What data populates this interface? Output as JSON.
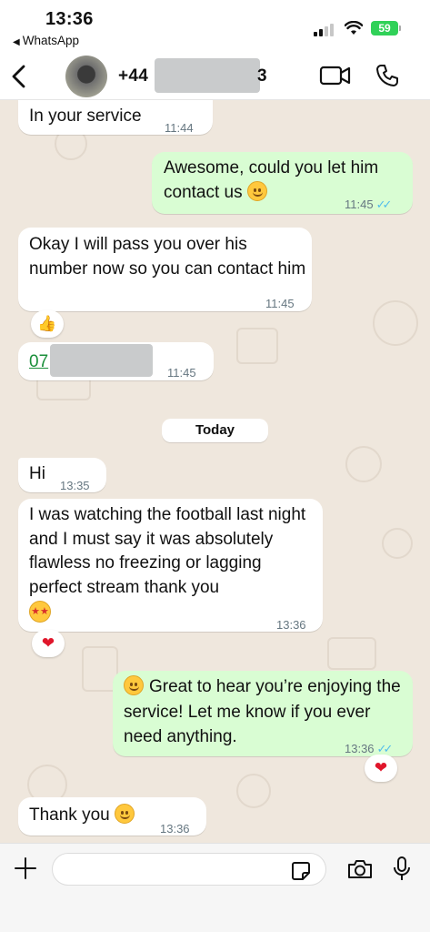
{
  "status_bar": {
    "time": "13:36",
    "back_app": "WhatsApp",
    "battery": "59"
  },
  "header": {
    "contact_prefix": "+44",
    "contact_suffix": "3"
  },
  "messages": [
    {
      "direction": "in",
      "text": "In your service",
      "time": "11:44"
    },
    {
      "direction": "out",
      "text": "Awesome, could you let him contact us",
      "emoji": "smiling-face",
      "time": "11:45",
      "read": true
    },
    {
      "direction": "in",
      "text": "Okay I will pass you over his number now so you can contact him",
      "time": "11:45",
      "reaction": "👍"
    },
    {
      "direction": "in",
      "link_text": "07",
      "time": "11:45"
    },
    {
      "direction": "in",
      "text": "Hi",
      "time": "13:35"
    },
    {
      "direction": "in",
      "text": "I was watching the football last night and I must say it was absolutely flawless no freezing or lagging perfect stream thank you",
      "emoji": "star-struck",
      "time": "13:36",
      "reaction": "❤"
    },
    {
      "direction": "out",
      "text": "Great to hear you’re enjoying the service! Let me know if you ever need anything.",
      "emoji": "smiling-face",
      "time": "13:36",
      "read": true,
      "reaction": "❤"
    },
    {
      "direction": "in",
      "text": "Thank you",
      "emoji": "smiling-face-blush",
      "time": "13:36"
    }
  ],
  "day_separator": "Today",
  "composer": {
    "placeholder": ""
  },
  "colors": {
    "outgoing_bubble": "#d9fdd3",
    "incoming_bubble": "#ffffff",
    "chat_background": "#efe7dd",
    "read_ticks": "#53bdeb",
    "battery": "#30d158"
  },
  "icons": [
    "back-chevron-icon",
    "video-call-icon",
    "phone-icon",
    "plus-icon",
    "sticker-icon",
    "camera-icon",
    "microphone-icon",
    "signal-icon",
    "wifi-icon",
    "battery-icon"
  ]
}
